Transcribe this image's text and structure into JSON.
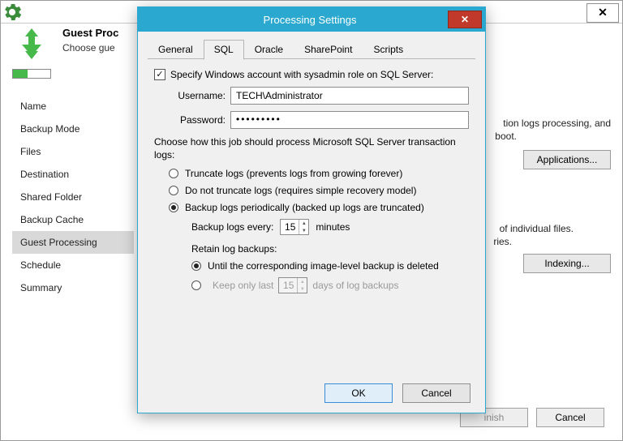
{
  "wizard": {
    "heading_title": "Guest Proc",
    "heading_sub": "Choose gue",
    "close_glyph": "✕",
    "sidebar": [
      "Name",
      "Backup Mode",
      "Files",
      "Destination",
      "Shared Folder",
      "Backup Cache",
      "Guest Processing",
      "Schedule",
      "Summary"
    ],
    "sidebar_active_index": 6,
    "content": {
      "frag1": "tion logs processing, and",
      "frag2": "boot.",
      "frag3": "of individual files.",
      "frag4": "ries.",
      "btn_applications": "Applications...",
      "btn_indexing": "Indexing..."
    },
    "footer": {
      "finish": "inish",
      "cancel": "Cancel"
    }
  },
  "dialog": {
    "title": "Processing Settings",
    "close_glyph": "✕",
    "tabs": [
      "General",
      "SQL",
      "Oracle",
      "SharePoint",
      "Scripts"
    ],
    "active_tab_index": 1,
    "specify_label": "Specify Windows account with sysadmin role on SQL Server:",
    "specify_checked_glyph": "✓",
    "username_label": "Username:",
    "username_value": "TECH\\Administrator",
    "password_label": "Password:",
    "password_value": "•••••••••",
    "choose_text": "Choose how this job should process Microsoft SQL Server transaction logs:",
    "radio1": "Truncate logs (prevents logs from growing forever)",
    "radio2": "Do not truncate logs (requires simple recovery model)",
    "radio3": "Backup logs periodically (backed up logs are truncated)",
    "backup_every_label": "Backup logs every:",
    "backup_every_value": "15",
    "backup_every_unit": "minutes",
    "retain_label": "Retain log backups:",
    "retain_opt1": "Until the corresponding image-level backup is deleted",
    "retain_opt2_pre": "Keep only last",
    "retain_opt2_value": "15",
    "retain_opt2_post": "days of log backups",
    "ok": "OK",
    "cancel": "Cancel"
  }
}
